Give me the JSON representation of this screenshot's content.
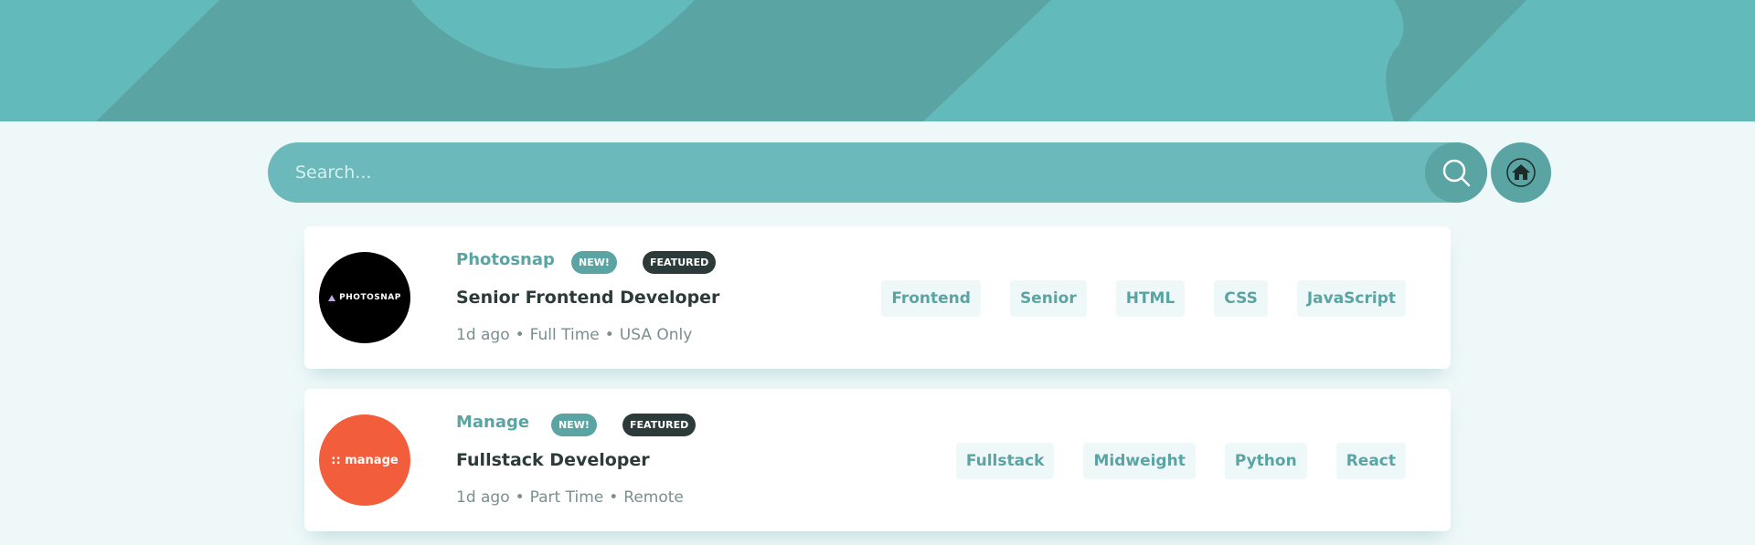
{
  "search": {
    "placeholder": "Search..."
  },
  "icons": {
    "search": "search-icon",
    "home": "home-icon"
  },
  "colors": {
    "primary": "#5ba4a4",
    "background": "#eff8f9",
    "featured": "#2c3a3a",
    "manage_logo": "#f25d3c",
    "photosnap_logo": "#000000"
  },
  "jobs": [
    {
      "company": "Photosnap",
      "logo_text": "PHOTOSNAP",
      "new_label": "NEW!",
      "featured_label": "FEATURED",
      "position": "Senior Frontend Developer",
      "posted": "1d ago",
      "contract": "Full Time",
      "location": "USA Only",
      "tags": [
        "Frontend",
        "Senior",
        "HTML",
        "CSS",
        "JavaScript"
      ]
    },
    {
      "company": "Manage",
      "logo_text": ":: manage",
      "new_label": "NEW!",
      "featured_label": "FEATURED",
      "position": "Fullstack Developer",
      "posted": "1d ago",
      "contract": "Part Time",
      "location": "Remote",
      "tags": [
        "Fullstack",
        "Midweight",
        "Python",
        "React"
      ]
    }
  ]
}
